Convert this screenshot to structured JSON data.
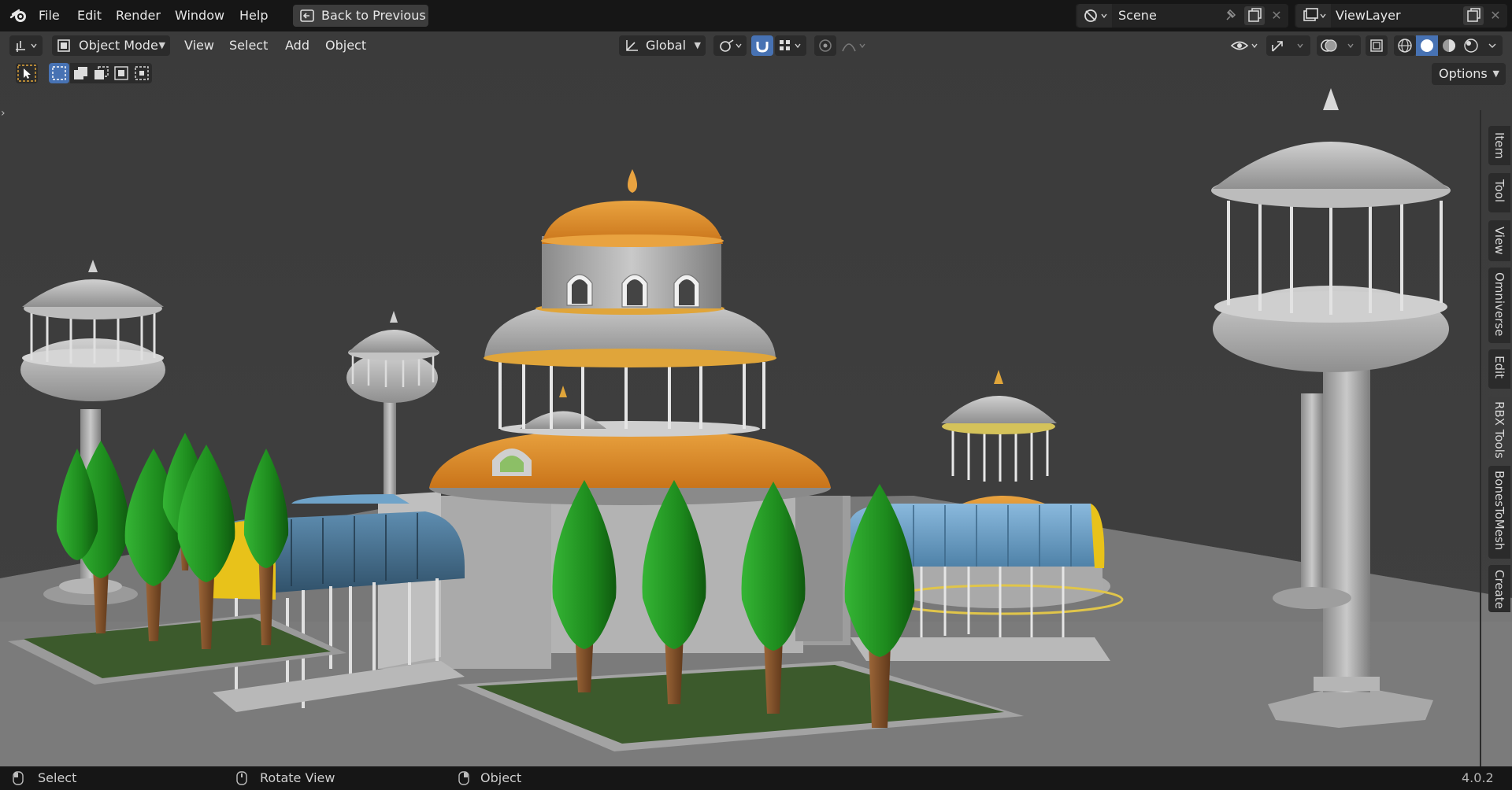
{
  "menu": {
    "items": [
      "File",
      "Edit",
      "Render",
      "Window",
      "Help"
    ],
    "back_button": "Back to Previous"
  },
  "scene_selector": {
    "name": "Scene"
  },
  "view_layer_selector": {
    "name": "ViewLayer"
  },
  "viewport_header": {
    "mode": "Object Mode",
    "menus": [
      "View",
      "Select",
      "Add",
      "Object"
    ],
    "transform_orientation": "Global"
  },
  "tool_settings": {
    "options_label": "Options"
  },
  "sidebar_tabs": [
    "Item",
    "Tool",
    "View",
    "Omniverse",
    "Edit",
    "RBX Tools",
    "BonesToMesh",
    "Create"
  ],
  "status_bar": {
    "items": [
      "Select",
      "Rotate View",
      "Object"
    ],
    "version": "4.0.2"
  },
  "colors": {
    "accent": "#4772b3",
    "viewport_bg": "#3d3d3d",
    "header_bg": "#161616",
    "dome_orange": "#d9882a",
    "tree_green": "#1f8a1f",
    "awning_blue": "#5d8fb3",
    "awning_yellow": "#e8c21a"
  }
}
